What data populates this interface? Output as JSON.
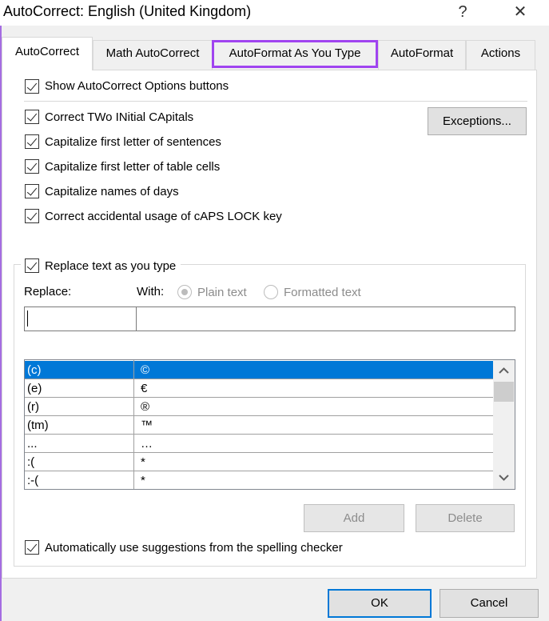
{
  "window": {
    "title": "AutoCorrect: English (United Kingdom)",
    "help": "?",
    "close": "✕"
  },
  "tabs": [
    {
      "label": "AutoCorrect",
      "active": true
    },
    {
      "label": "Math AutoCorrect"
    },
    {
      "label": "AutoFormat As You Type",
      "highlighted": true,
      "highlight_color": "#a044f0"
    },
    {
      "label": "AutoFormat"
    },
    {
      "label": "Actions"
    }
  ],
  "options": [
    {
      "label": "Show AutoCorrect Options buttons",
      "checked": true
    },
    {
      "label": "Correct TWo INitial CApitals",
      "checked": true
    },
    {
      "label": "Capitalize first letter of sentences",
      "checked": true
    },
    {
      "label": "Capitalize first letter of table cells",
      "checked": true
    },
    {
      "label": "Capitalize names of days",
      "checked": true
    },
    {
      "label": "Correct accidental usage of cAPS LOCK key",
      "checked": true
    }
  ],
  "exceptions_button": "Exceptions...",
  "replace": {
    "checkbox": "Replace text as you type",
    "checked": true,
    "replace_label": "Replace:",
    "with_label": "With:",
    "plain_text": "Plain text",
    "formatted_text": "Formatted text",
    "selected_format": "Plain text",
    "replace_value": "",
    "with_value": "",
    "entries": [
      [
        "(c)",
        "©"
      ],
      [
        "(e)",
        "€"
      ],
      [
        "(r)",
        "®"
      ],
      [
        "(tm)",
        "™"
      ],
      [
        "...",
        "…"
      ],
      [
        ":(",
        "*"
      ],
      [
        ":-(",
        "*"
      ]
    ],
    "selected_index": 0,
    "add": "Add",
    "delete": "Delete"
  },
  "spelling_checkbox": {
    "label": "Automatically use suggestions from the spelling checker",
    "checked": true
  },
  "footer": {
    "ok": "OK",
    "cancel": "Cancel"
  },
  "colors": {
    "selection": "#0078d7",
    "ok_border": "#0078d7"
  }
}
